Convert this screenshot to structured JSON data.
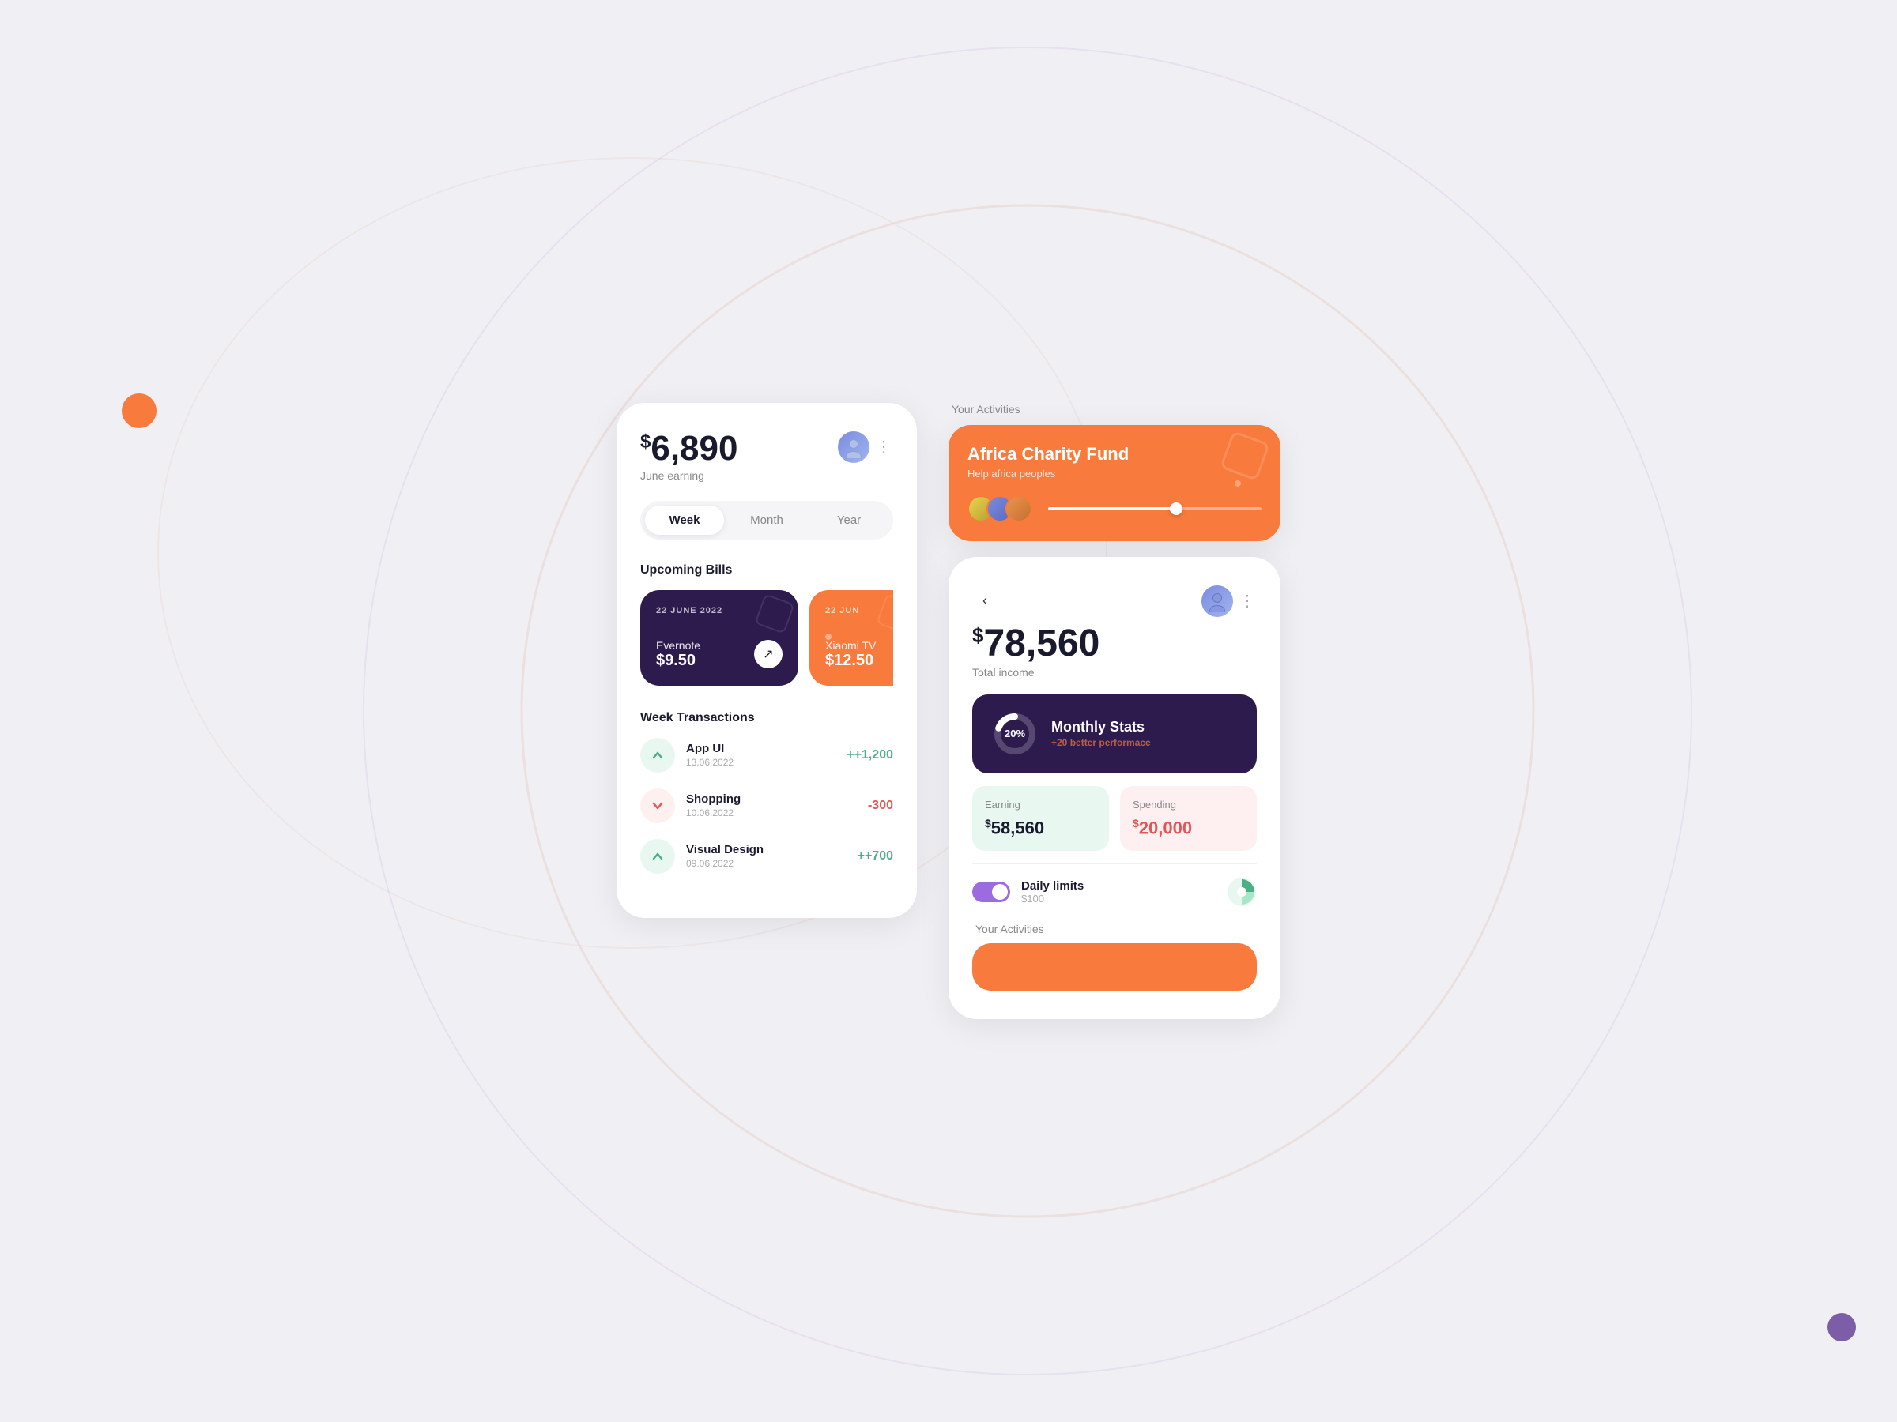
{
  "background": "#f0f0f4",
  "left_card": {
    "earning": {
      "currency": "$",
      "amount": "6,890",
      "label": "June earning"
    },
    "tabs": [
      {
        "label": "Week",
        "active": true
      },
      {
        "label": "Month",
        "active": false
      },
      {
        "label": "Year",
        "active": false
      }
    ],
    "upcoming_bills": {
      "section_label": "Upcoming Bills",
      "items": [
        {
          "date": "22 JUNE 2022",
          "name": "Evernote",
          "amount": "$9.50",
          "color": "purple"
        },
        {
          "date": "22 JUN",
          "name": "Xiaomi TV",
          "amount": "$12.50",
          "color": "orange"
        }
      ]
    },
    "transactions": {
      "section_label": "Week Transactions",
      "items": [
        {
          "name": "App UI",
          "date": "13.06.2022",
          "amount": "+1,200",
          "positive": true
        },
        {
          "name": "Shopping",
          "date": "10.06.2022",
          "amount": "-300",
          "positive": false
        },
        {
          "name": "Visual Design",
          "date": "09.06.2022",
          "amount": "+700",
          "positive": true
        }
      ]
    }
  },
  "right_top": {
    "activities_label": "Your Activities",
    "charity": {
      "title": "Africa Charity Fund",
      "subtitle": "Help africa peoples",
      "progress": 60
    }
  },
  "right_card": {
    "total": {
      "currency": "$",
      "amount": "78,560",
      "label": "Total income"
    },
    "monthly_stats": {
      "percent": "20%",
      "title": "Monthly Stats",
      "sub_prefix": "+20",
      "sub_text": " better performace"
    },
    "earning": {
      "label": "Earning",
      "currency": "$",
      "amount": "58,560"
    },
    "spending": {
      "label": "Spending",
      "currency": "$",
      "amount": "20,000"
    },
    "daily_limits": {
      "title": "Daily limits",
      "amount": "$100"
    },
    "activities_label": "Your Activities"
  }
}
